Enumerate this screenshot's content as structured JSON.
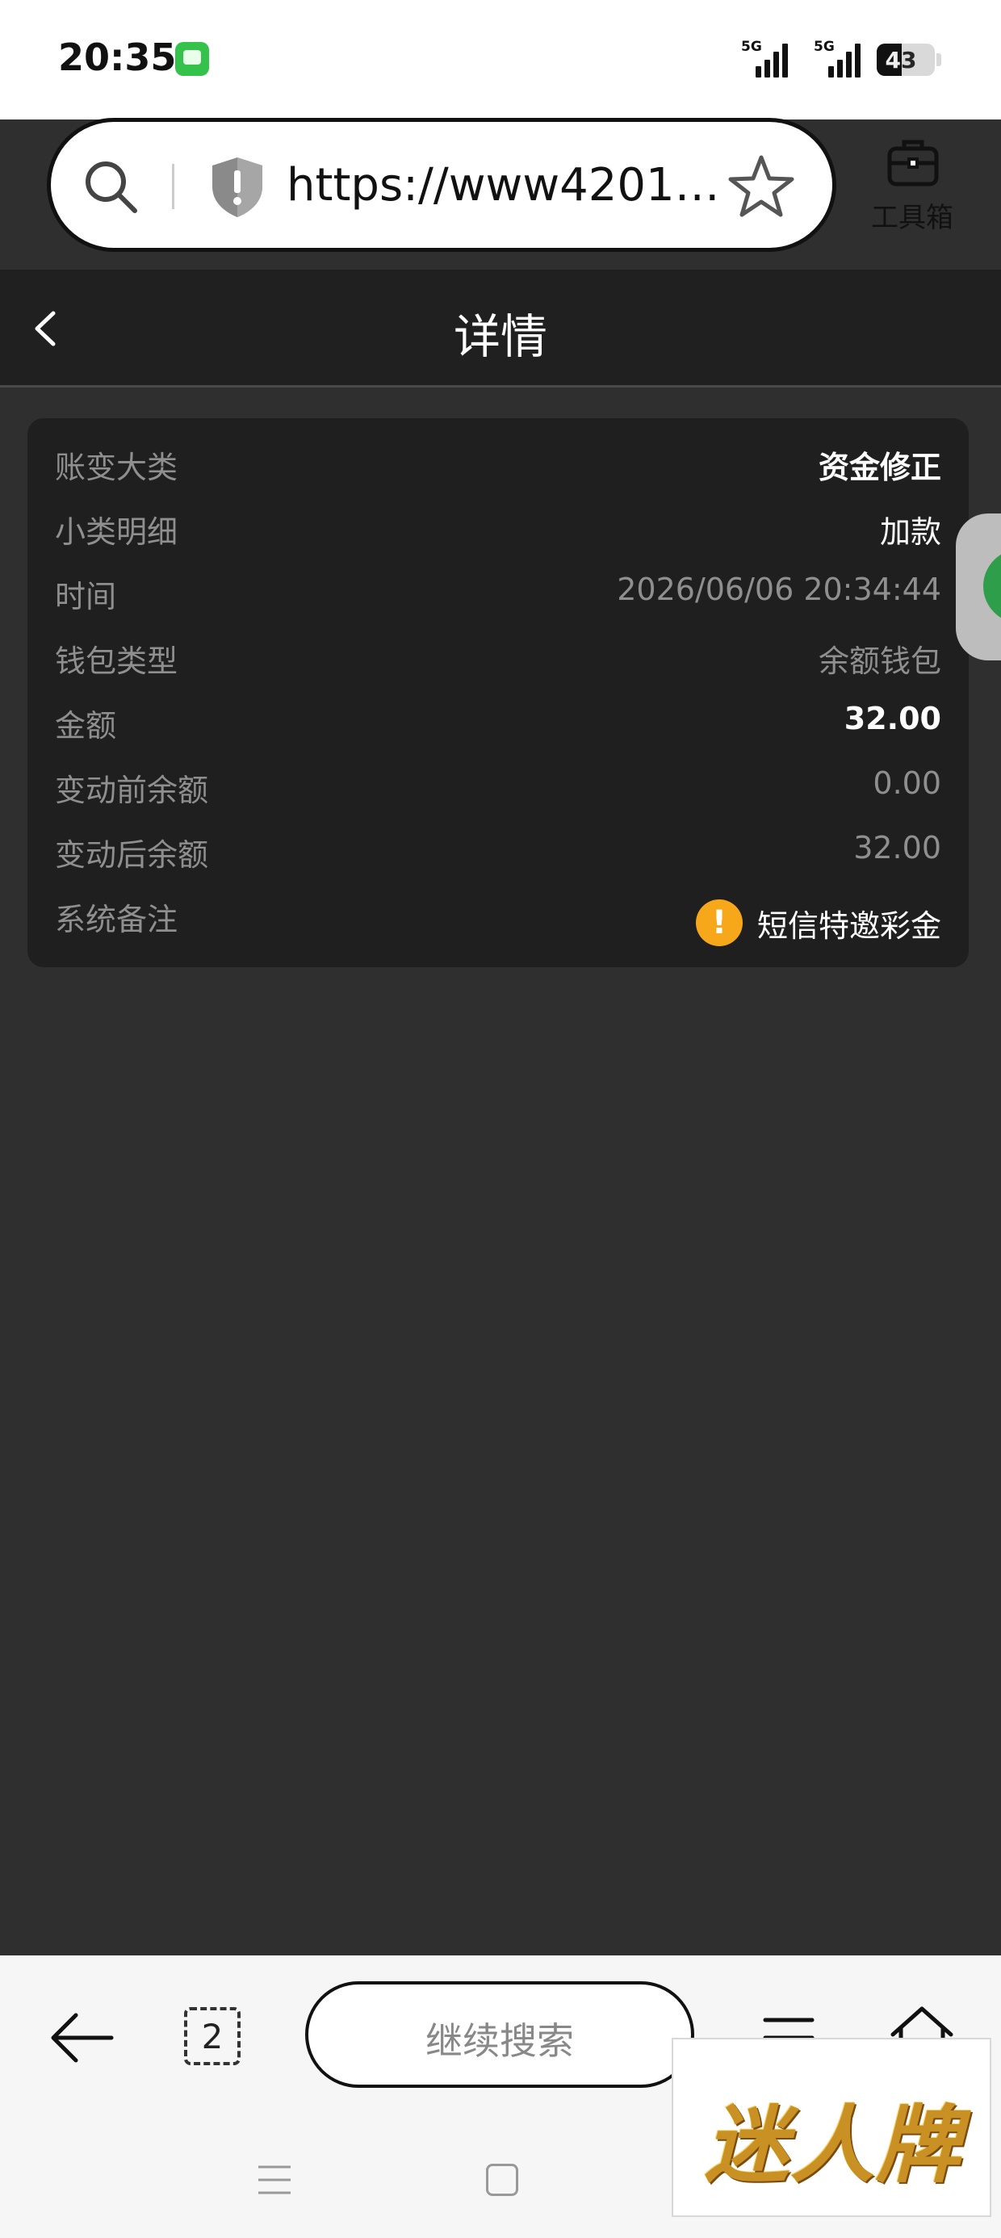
{
  "status_bar": {
    "time": "20:35",
    "signal1_label": "5G",
    "signal2_label": "5G",
    "battery_level": "43",
    "battery_fraction": 0.43
  },
  "browser": {
    "url": "https://www42012...",
    "toolbox_label": "工具箱",
    "continue_search_label": "继续搜索",
    "tab_count": "2"
  },
  "header": {
    "title": "详情"
  },
  "details": {
    "rows": [
      {
        "label": "账变大类",
        "value": "资金修正"
      },
      {
        "label": "小类明细",
        "value": "加款"
      },
      {
        "label": "时间",
        "value": "2026/06/06 20:34:44"
      },
      {
        "label": "钱包类型",
        "value": "余额钱包"
      },
      {
        "label": "金额",
        "value": "32.00"
      },
      {
        "label": "变动前余额",
        "value": "0.00"
      },
      {
        "label": "变动后余额",
        "value": "32.00"
      },
      {
        "label": "系统备注",
        "value": "短信特邀彩金"
      }
    ]
  },
  "watermark": {
    "text": "迷人牌"
  },
  "colors": {
    "page_bg": "#2f2f2f",
    "header_bg": "#202020",
    "card_bg": "#1f1f1f",
    "label_grey": "#8f8f8f",
    "warning_orange": "#f6a81a"
  },
  "icons": [
    "message-app-icon",
    "search-icon",
    "shield-icon",
    "star-icon",
    "toolbox-icon",
    "back-chevron-icon",
    "warning-icon",
    "back-arrow-icon",
    "menu-icon",
    "home-icon"
  ]
}
